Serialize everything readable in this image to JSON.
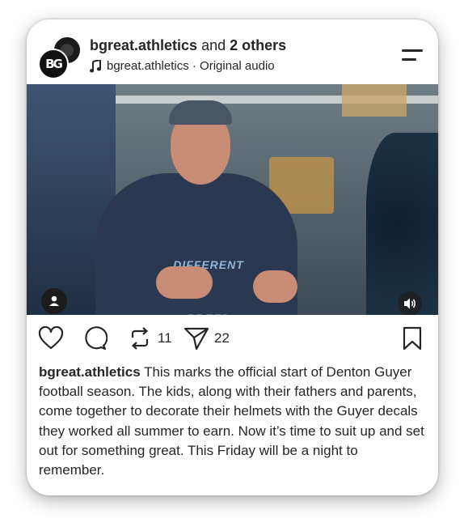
{
  "header": {
    "username": "bgreat.athletics",
    "and_text": "and",
    "others": "2 others",
    "audio_text": "bgreat.athletics · Original audio",
    "avatar_initials": "BG"
  },
  "media": {
    "shirt_text": "DIFFERENT BREED"
  },
  "actions": {
    "repost_count": "11",
    "share_count": "22"
  },
  "caption": {
    "username": "bgreat.athletics",
    "text": "This marks the official start of Denton Guyer football season. The kids, along with their fathers and parents, come together to decorate their helmets with the Guyer decals they worked all summer to earn. Now it’s time to suit up and set out for something great. This Friday will be a night to remember."
  },
  "icons": [
    "music-note-icon",
    "menu-icon",
    "user-tag-icon",
    "speaker-icon",
    "heart-icon",
    "comment-icon",
    "repost-icon",
    "share-icon",
    "bookmark-icon"
  ]
}
